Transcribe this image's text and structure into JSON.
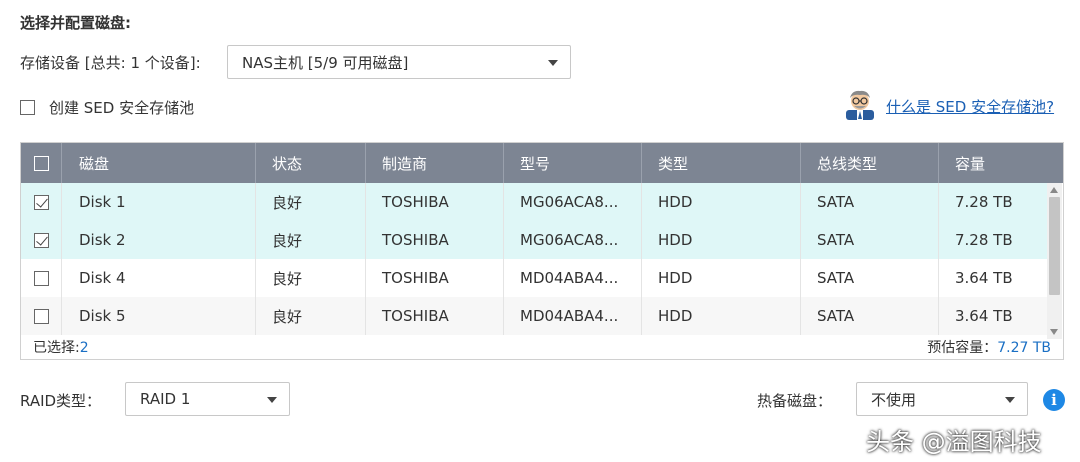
{
  "section_title": "选择并配置磁盘:",
  "storage": {
    "label": "存储设备 [总共: 1 个设备]:",
    "selected": "NAS主机 [5/9 可用磁盘]"
  },
  "sed": {
    "checkbox_label": "创建 SED 安全存储池",
    "help_link": "什么是 SED 安全存储池?"
  },
  "table": {
    "columns": [
      "磁盘",
      "状态",
      "制造商",
      "型号",
      "类型",
      "总线类型",
      "容量"
    ],
    "rows": [
      {
        "checked": true,
        "disk": "Disk 1",
        "status": "良好",
        "maker": "TOSHIBA",
        "model": "MG06ACA8...",
        "type": "HDD",
        "bus": "SATA",
        "capacity": "7.28 TB"
      },
      {
        "checked": true,
        "disk": "Disk 2",
        "status": "良好",
        "maker": "TOSHIBA",
        "model": "MG06ACA8...",
        "type": "HDD",
        "bus": "SATA",
        "capacity": "7.28 TB"
      },
      {
        "checked": false,
        "disk": "Disk 4",
        "status": "良好",
        "maker": "TOSHIBA",
        "model": "MD04ABA4...",
        "type": "HDD",
        "bus": "SATA",
        "capacity": "3.64 TB"
      },
      {
        "checked": false,
        "disk": "Disk 5",
        "status": "良好",
        "maker": "TOSHIBA",
        "model": "MD04ABA4...",
        "type": "HDD",
        "bus": "SATA",
        "capacity": "3.64 TB"
      }
    ],
    "selected_label": "已选择:",
    "selected_count": "2",
    "estimated_label": "预估容量：",
    "estimated_value": "7.27 TB"
  },
  "raid": {
    "label": "RAID类型：",
    "selected": "RAID 1"
  },
  "spare": {
    "label": "热备磁盘：",
    "selected": "不使用"
  },
  "watermark": "头条 @溢图科技",
  "icons": {
    "help": "helper-person-icon",
    "info": "info-icon",
    "dropdown": "chevron-down-icon"
  }
}
